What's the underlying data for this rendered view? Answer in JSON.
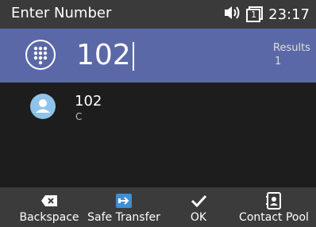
{
  "status": {
    "title": "Enter Number",
    "time": "23:17",
    "line_number": "1"
  },
  "dial": {
    "number": "102",
    "results_label": "Results",
    "results_count": "1"
  },
  "results": [
    {
      "name": "102",
      "sub": "C"
    }
  ],
  "softkeys": {
    "backspace": "Backspace",
    "safe_transfer": "Safe Transfer",
    "ok": "OK",
    "contact_pool": "Contact Pool"
  },
  "colors": {
    "accent": "#5b68a8",
    "avatar": "#8fc3ea",
    "transfer_icon": "#3d8fd6"
  },
  "icons": [
    "dialpad-icon",
    "speaker-icon",
    "line-icon",
    "backspace-icon",
    "transfer-icon",
    "check-icon",
    "contact-book-icon",
    "user-icon"
  ]
}
